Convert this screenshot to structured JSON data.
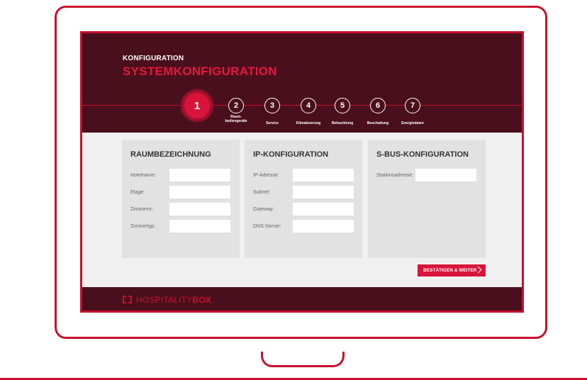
{
  "header": {
    "small_title": "KONFIGURATION",
    "big_title": "SYSTEMKONFIGURATION"
  },
  "steps": [
    {
      "number": "1",
      "label": ""
    },
    {
      "number": "2",
      "label": "Raum-\nbediengeräte"
    },
    {
      "number": "3",
      "label": "Service"
    },
    {
      "number": "4",
      "label": "Klimatisierung"
    },
    {
      "number": "5",
      "label": "Beleuchtung"
    },
    {
      "number": "6",
      "label": "Beschattung"
    },
    {
      "number": "7",
      "label": "Energiedaten"
    }
  ],
  "panels": {
    "room": {
      "title": "RAUMBEZEICHNUNG",
      "fields": [
        {
          "label": "Hotelname:",
          "value": ""
        },
        {
          "label": "Etage:",
          "value": ""
        },
        {
          "label": "Zimmernr.:",
          "value": ""
        },
        {
          "label": "Zimmertyp:",
          "value": ""
        }
      ]
    },
    "ip": {
      "title": "IP-KONFIGURATION",
      "fields": [
        {
          "label": "IP-Adresse:",
          "value": ""
        },
        {
          "label": "Subnet:",
          "value": ""
        },
        {
          "label": "Gateway:",
          "value": ""
        },
        {
          "label": "DNS-Server:",
          "value": ""
        }
      ]
    },
    "sbus": {
      "title": "S-BUS-KONFIGURATION",
      "fields": [
        {
          "label": "Stationsadresse:",
          "value": ""
        }
      ]
    }
  },
  "confirm_button": {
    "label": "BESTÄTIGEN & WEITER"
  },
  "footer": {
    "logo_light": "HOSPITALITY",
    "logo_bold": "BOX"
  },
  "colors": {
    "accent": "#d9143a",
    "frame": "#c8102e",
    "header_bg": "#4a0f1c",
    "panel_bg": "#e2e2e2",
    "page_bg": "#f0f0f0"
  },
  "icons": {
    "logo": "bracket-box-icon",
    "confirm": "chevron-right-icon"
  }
}
